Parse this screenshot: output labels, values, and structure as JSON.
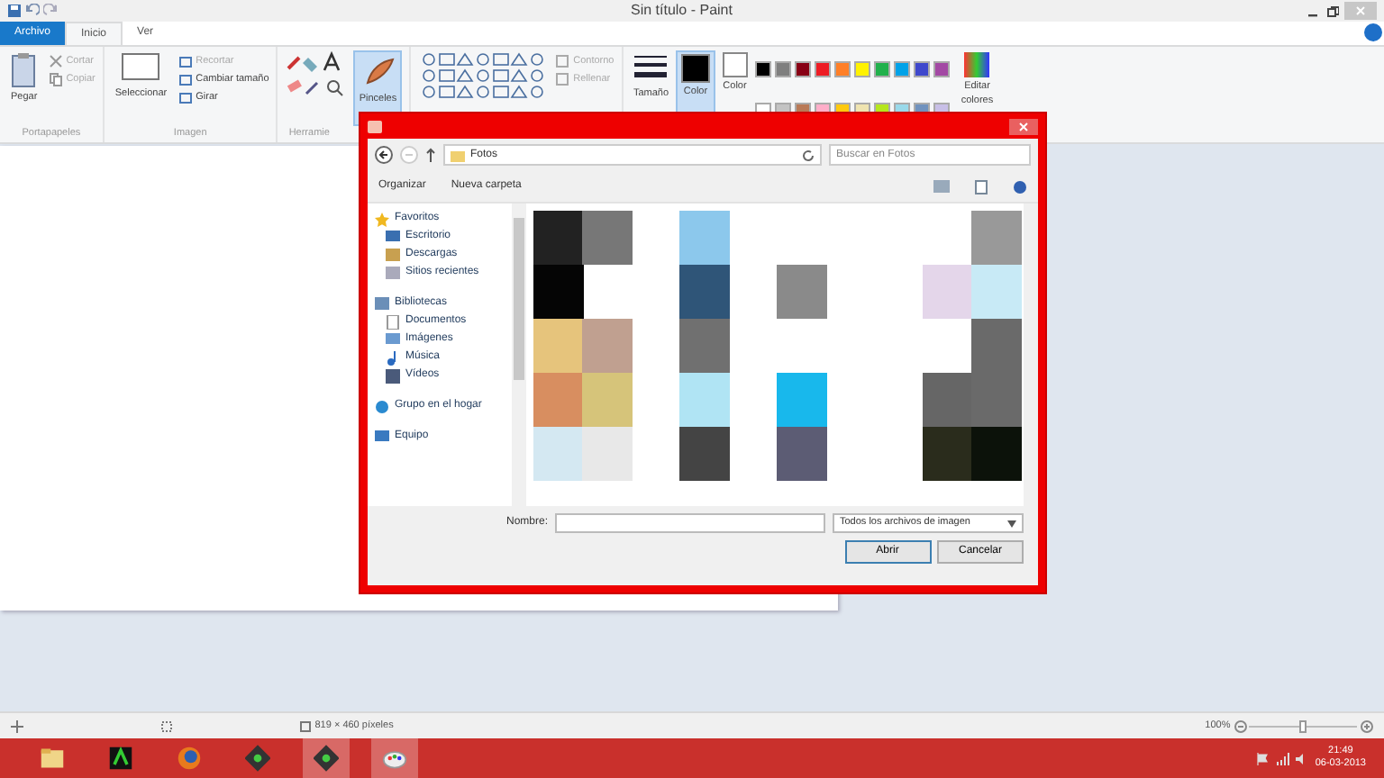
{
  "window": {
    "title": "Sin título - Paint"
  },
  "ribbon_tabs": [
    {
      "label": "Archivo",
      "kind": "file",
      "selected": false
    },
    {
      "label": "Inicio",
      "kind": "tab",
      "selected": true
    },
    {
      "label": "Ver",
      "kind": "tab",
      "selected": false
    }
  ],
  "clipboard": {
    "label": "Portapapeles",
    "paste": "Pegar",
    "cut": "Cortar",
    "copy": "Copiar"
  },
  "image": {
    "label": "Imagen",
    "select": "Seleccionar",
    "crop": "Recortar",
    "resize": "Cambiar tamaño",
    "rotate": "Girar"
  },
  "tools": {
    "label": "Herramie",
    "brushes": {
      "label": "Pinceles",
      "selected": true
    }
  },
  "shapes": {
    "outline": "Contorno",
    "fill": "Rellenar"
  },
  "size": {
    "label": "Tamaño"
  },
  "color1": {
    "label": "Color",
    "selected": true
  },
  "color2": {
    "label": "Color"
  },
  "palette": [
    {
      "color": "#000000"
    },
    {
      "color": "#7f7f7f"
    },
    {
      "color": "#880015"
    },
    {
      "color": "#ed1c24"
    },
    {
      "color": "#ff7f27"
    },
    {
      "color": "#fff200"
    },
    {
      "color": "#22b14c"
    },
    {
      "color": "#00a2e8"
    },
    {
      "color": "#3f48cc"
    },
    {
      "color": "#a349a4"
    },
    {
      "color": "#ffffff"
    },
    {
      "color": "#c3c3c3"
    },
    {
      "color": "#b97a57"
    },
    {
      "color": "#ffaec9"
    },
    {
      "color": "#ffc90e"
    },
    {
      "color": "#efe4b0"
    },
    {
      "color": "#b5e61d"
    },
    {
      "color": "#99d9ea"
    },
    {
      "color": "#7092be"
    },
    {
      "color": "#c8bfe7"
    }
  ],
  "edit_colors": "Editar colores",
  "dialog": {
    "path": "Fotos",
    "search_placeholder": "Buscar en Fotos",
    "organize": "Organizar",
    "new_folder": "Nueva carpeta",
    "nav": [
      {
        "label": "Favoritos",
        "kind": "star",
        "children": [
          {
            "label": "Escritorio",
            "kind": "desktop"
          },
          {
            "label": "Descargas",
            "kind": "download"
          },
          {
            "label": "Sitios recientes",
            "kind": "recent"
          }
        ]
      },
      {
        "label": "Bibliotecas",
        "kind": "library",
        "children": [
          {
            "label": "Documentos",
            "kind": "doc"
          },
          {
            "label": "Imágenes",
            "kind": "pic"
          },
          {
            "label": "Música",
            "kind": "music"
          },
          {
            "label": "Vídeos",
            "kind": "video"
          }
        ]
      },
      {
        "label": "Grupo en el hogar",
        "kind": "home"
      },
      {
        "label": "Equipo",
        "kind": "pc"
      }
    ],
    "name_label": "Nombre:",
    "filter": "Todos los archivos de imagen",
    "open": "Abrir",
    "cancel": "Cancelar"
  },
  "status_bar": {
    "dimensions": "819 × 460 píxeles",
    "zoom": "100%",
    "zoom_slider": {
      "level": 0.5
    }
  },
  "taskbar": {
    "apps": [
      {
        "kind": "folder",
        "active": false
      },
      {
        "kind": "green",
        "active": false
      },
      {
        "kind": "firefox",
        "active": false
      },
      {
        "kind": "dark",
        "active": false
      },
      {
        "kind": "dark",
        "active": true
      },
      {
        "kind": "paint",
        "active": true
      }
    ],
    "time": "21:49",
    "date": "06-03-2013"
  }
}
